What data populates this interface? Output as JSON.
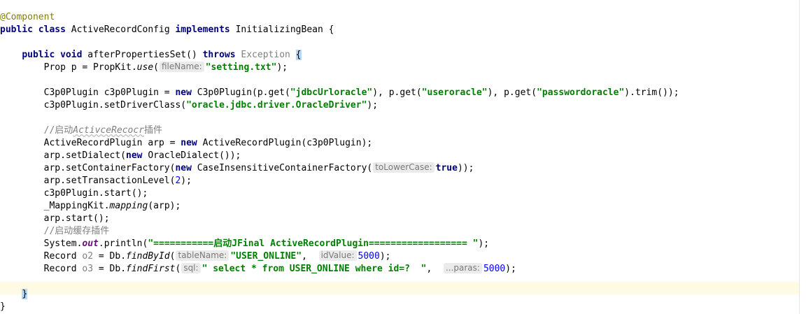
{
  "code": {
    "l1_annotation": "@Component",
    "l2_public": "public",
    "l2_class": "class",
    "l2_name": " ActiveRecordConfig ",
    "l2_implements": "implements",
    "l2_iface": " InitializingBean {",
    "l4_indent": "    ",
    "l4_public": "public",
    "l4_void": "void",
    "l4_method": " afterPropertiesSet() ",
    "l4_throws": "throws",
    "l4_exception": " Exception ",
    "l4_brace": "{",
    "l5_pre": "        Prop p = PropKit.",
    "l5_use": "use",
    "l5_paren": "(",
    "l5_hint": "fileName:",
    "l5_str": "\"setting.txt\"",
    "l5_post": ");",
    "l7_pre": "        C3p0Plugin c3p0Plugin = ",
    "l7_new": "new",
    "l7_mid1": " C3p0Plugin(p.get(",
    "l7_str1": "\"jdbcUrloracle\"",
    "l7_mid2": "), p.get(",
    "l7_str2": "\"useroracle\"",
    "l7_mid3": "), p.get(",
    "l7_str3": "\"passwordoracle\"",
    "l7_post": ").trim());",
    "l8_pre": "        c3p0Plugin.setDriverClass(",
    "l8_str": "\"oracle.jdbc.driver.OracleDriver\"",
    "l8_post": ");",
    "l10_comment_a": "        //启动",
    "l10_comment_b": "ActivceRecocr",
    "l10_comment_c": "插件",
    "l11_pre": "        ActiveRecordPlugin arp = ",
    "l11_new": "new",
    "l11_post": " ActiveRecordPlugin(c3p0Plugin);",
    "l12_pre": "        arp.setDialect(",
    "l12_new": "new",
    "l12_post": " OracleDialect());",
    "l13_pre": "        arp.setContainerFactory(",
    "l13_new": "new",
    "l13_mid": " CaseInsensitiveContainerFactory(",
    "l13_hint": "toLowerCase:",
    "l13_true": "true",
    "l13_post": "));",
    "l14_pre": "        arp.setTransactionLevel(",
    "l14_num": "2",
    "l14_post": ");",
    "l15": "        c3p0Plugin.start();",
    "l16_pre": "        _MappingKit.",
    "l16_mapping": "mapping",
    "l16_post": "(arp);",
    "l17": "        arp.start();",
    "l18_comment": "        //启动缓存插件",
    "l19_pre": "        System.",
    "l19_out": "out",
    "l19_mid": ".println(",
    "l19_str_a": "\"===========",
    "l19_str_cn": "启动",
    "l19_str_b": "JFinal ActiveRecordPlugin================== \"",
    "l19_post": ");",
    "l20_pre": "        Record ",
    "l20_var": "o2",
    "l20_mid": " = Db.",
    "l20_method": "findById",
    "l20_paren": "(",
    "l20_hint1": "tableName:",
    "l20_str": "\"USER_ONLINE\"",
    "l20_comma": ",  ",
    "l20_hint2": "idValue:",
    "l20_num": "5000",
    "l20_post": ");",
    "l21_pre": "        Record ",
    "l21_var": "o3",
    "l21_mid": " = Db.",
    "l21_method": "findFirst",
    "l21_paren": "(",
    "l21_hint1": "sql:",
    "l21_str": "\" select * from USER_ONLINE where id=?  \"",
    "l21_comma": ",  ",
    "l21_hint2": "...paras:",
    "l21_num": "5000",
    "l21_post": ");",
    "l23_indent": "    ",
    "l23_brace": "}",
    "l24": "}"
  }
}
